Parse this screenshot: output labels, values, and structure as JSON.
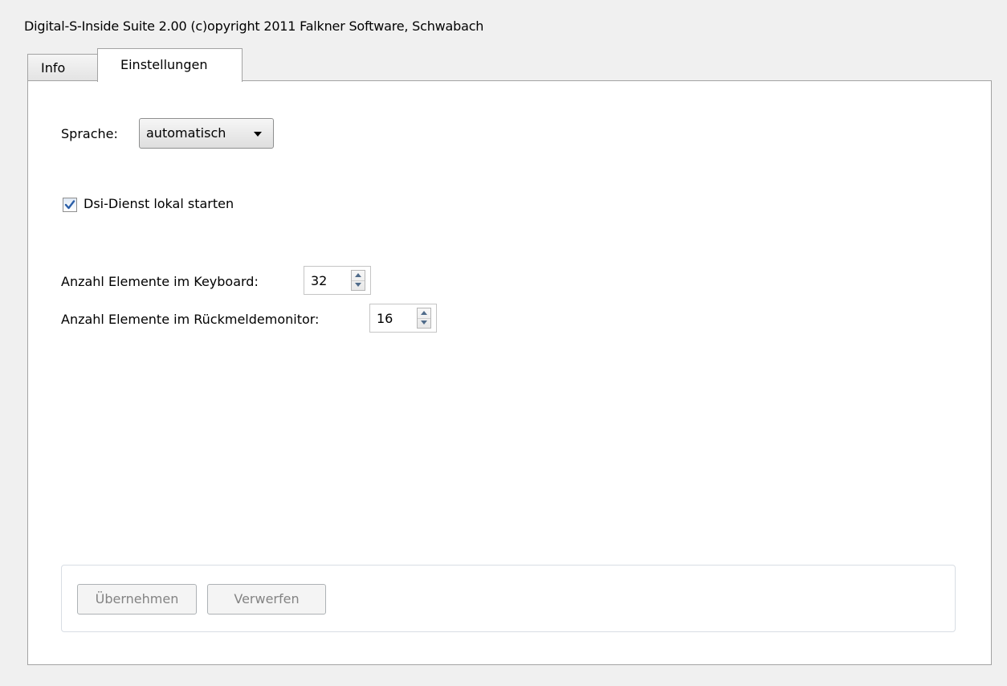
{
  "window": {
    "title": "Digital-S-Inside Suite 2.00 (c)opyright 2011 Falkner Software, Schwabach"
  },
  "tabs": [
    {
      "label": "Info",
      "active": false
    },
    {
      "label": "Einstellungen",
      "active": true
    }
  ],
  "settings": {
    "language_label": "Sprache:",
    "language_value": "automatisch",
    "service_checkbox_label": "Dsi-Dienst lokal starten",
    "service_checkbox_checked": true,
    "keyboard_label": "Anzahl Elemente im Keyboard:",
    "keyboard_value": "32",
    "monitor_label": "Anzahl Elemente im Rückmeldemonitor:",
    "monitor_value": "16"
  },
  "actions": {
    "apply_label": "Übernehmen",
    "discard_label": "Verwerfen",
    "enabled": false
  },
  "icons": {
    "combo_arrow": "chevron-down-icon",
    "checkbox": "checkmark-icon",
    "spinner_up": "arrow-up-icon",
    "spinner_down": "arrow-down-icon"
  },
  "colors": {
    "window_bg": "#f0f0f0",
    "panel_bg": "#ffffff",
    "border": "#a3a3a3",
    "checkmark": "#2a5ea8",
    "disabled_text": "#838383"
  }
}
